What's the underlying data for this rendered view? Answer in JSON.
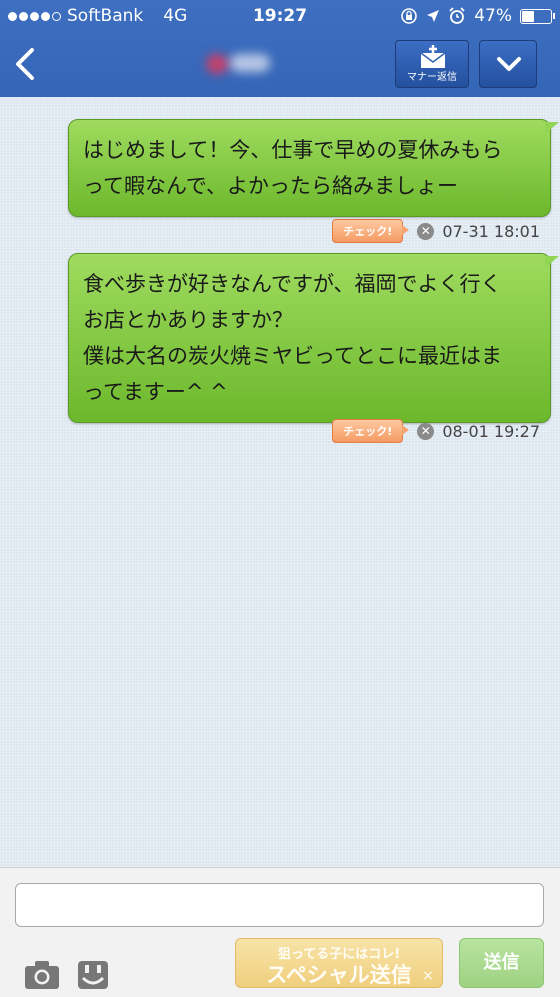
{
  "status_bar": {
    "carrier": "SoftBank",
    "network": "4G",
    "time": "19:27",
    "battery_percent": "47%",
    "battery_level": 0.47,
    "icons": [
      "rotation-lock-icon",
      "location-icon",
      "alarm-icon",
      "battery-icon"
    ]
  },
  "header": {
    "manner_reply_label": "マナー返信"
  },
  "messages": [
    {
      "lines": [
        "はじめまして！今、仕事で早めの夏休みもら",
        "って暇なんで、よかったら絡みましょー"
      ],
      "check_label": "チェック!",
      "timestamp": "07-31 18:01"
    },
    {
      "lines": [
        "食べ歩きが好きなんですが、福岡でよく行く",
        "お店とかありますか？",
        "僕は大名の炭火焼ミヤビってとこに最近はま",
        "ってますー^ ^"
      ],
      "check_label": "チェック!",
      "timestamp": "08-01 19:27"
    }
  ],
  "composer": {
    "input_value": "",
    "special_send_top": "狙ってる子にはコレ!",
    "special_send_main": "スペシャル送信",
    "special_close": "×",
    "send_label": "送信"
  },
  "colors": {
    "header_blue": "#3565b6",
    "bubble_green": "#7cc63a",
    "check_badge": "#f49a63",
    "send_green": "#9fd283"
  }
}
